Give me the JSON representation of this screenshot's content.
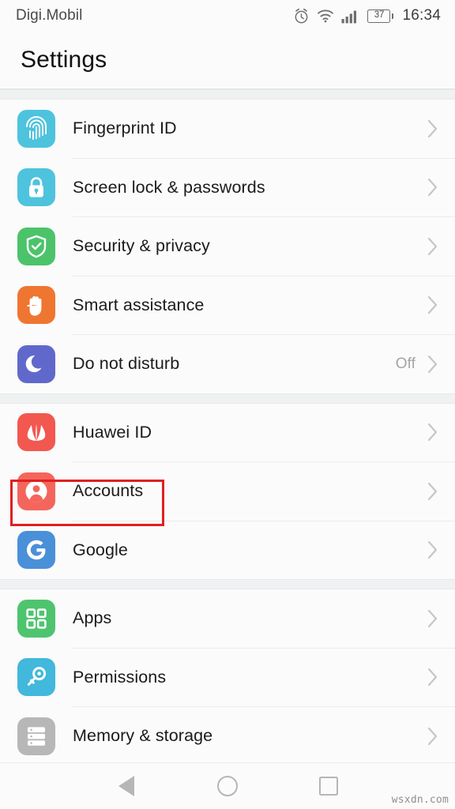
{
  "status_bar": {
    "carrier": "Digi.Mobil",
    "battery_level": "37",
    "time": "16:34",
    "icons": [
      "alarm-clock-icon",
      "wifi-icon",
      "signal-bars-icon",
      "battery-icon"
    ]
  },
  "header": {
    "title": "Settings"
  },
  "colors": {
    "fingerprint": "#4ec3dd",
    "screen_lock": "#4ec3dd",
    "security": "#4cc36a",
    "smart_assistance": "#ef7631",
    "do_not_disturb": "#6069cb",
    "huawei": "#f2584f",
    "accounts": "#f4665c",
    "google": "#4a90d9",
    "apps": "#4ec46f",
    "permissions": "#41b8dc",
    "memory": "#b7b7b7",
    "highlight": "#e02020"
  },
  "groups": [
    {
      "name": "security-group",
      "items": [
        {
          "label": "Fingerprint ID",
          "icon": "fingerprint-icon",
          "value": "",
          "highlighted": false
        },
        {
          "label": "Screen lock & passwords",
          "icon": "lock-icon",
          "value": "",
          "highlighted": false
        },
        {
          "label": "Security & privacy",
          "icon": "shield-check-icon",
          "value": "",
          "highlighted": false
        },
        {
          "label": "Smart assistance",
          "icon": "hand-icon",
          "value": "",
          "highlighted": false
        },
        {
          "label": "Do not disturb",
          "icon": "moon-icon",
          "value": "Off",
          "highlighted": false
        }
      ]
    },
    {
      "name": "accounts-group",
      "items": [
        {
          "label": "Huawei ID",
          "icon": "huawei-logo-icon",
          "value": "",
          "highlighted": false
        },
        {
          "label": "Accounts",
          "icon": "person-icon",
          "value": "",
          "highlighted": true
        },
        {
          "label": "Google",
          "icon": "google-g-icon",
          "value": "",
          "highlighted": false
        }
      ]
    },
    {
      "name": "system-group",
      "items": [
        {
          "label": "Apps",
          "icon": "apps-grid-icon",
          "value": "",
          "highlighted": false
        },
        {
          "label": "Permissions",
          "icon": "key-icon",
          "value": "",
          "highlighted": false
        },
        {
          "label": "Memory & storage",
          "icon": "storage-icon",
          "value": "",
          "highlighted": false
        }
      ]
    }
  ],
  "nav_bar": {
    "back": "back-triangle-icon",
    "home": "home-circle-icon",
    "recents": "recents-square-icon"
  },
  "watermark": "wsxdn.com"
}
